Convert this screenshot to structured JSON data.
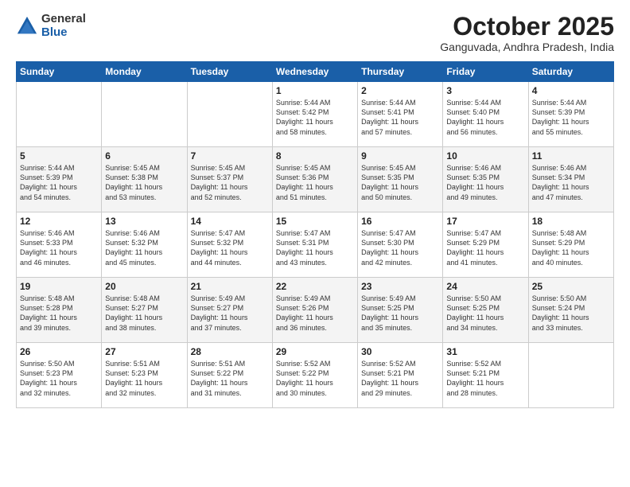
{
  "logo": {
    "general": "General",
    "blue": "Blue"
  },
  "title": "October 2025",
  "location": "Ganguvada, Andhra Pradesh, India",
  "weekdays": [
    "Sunday",
    "Monday",
    "Tuesday",
    "Wednesday",
    "Thursday",
    "Friday",
    "Saturday"
  ],
  "weeks": [
    [
      {
        "day": "",
        "content": ""
      },
      {
        "day": "",
        "content": ""
      },
      {
        "day": "",
        "content": ""
      },
      {
        "day": "1",
        "content": "Sunrise: 5:44 AM\nSunset: 5:42 PM\nDaylight: 11 hours\nand 58 minutes."
      },
      {
        "day": "2",
        "content": "Sunrise: 5:44 AM\nSunset: 5:41 PM\nDaylight: 11 hours\nand 57 minutes."
      },
      {
        "day": "3",
        "content": "Sunrise: 5:44 AM\nSunset: 5:40 PM\nDaylight: 11 hours\nand 56 minutes."
      },
      {
        "day": "4",
        "content": "Sunrise: 5:44 AM\nSunset: 5:39 PM\nDaylight: 11 hours\nand 55 minutes."
      }
    ],
    [
      {
        "day": "5",
        "content": "Sunrise: 5:44 AM\nSunset: 5:39 PM\nDaylight: 11 hours\nand 54 minutes."
      },
      {
        "day": "6",
        "content": "Sunrise: 5:45 AM\nSunset: 5:38 PM\nDaylight: 11 hours\nand 53 minutes."
      },
      {
        "day": "7",
        "content": "Sunrise: 5:45 AM\nSunset: 5:37 PM\nDaylight: 11 hours\nand 52 minutes."
      },
      {
        "day": "8",
        "content": "Sunrise: 5:45 AM\nSunset: 5:36 PM\nDaylight: 11 hours\nand 51 minutes."
      },
      {
        "day": "9",
        "content": "Sunrise: 5:45 AM\nSunset: 5:35 PM\nDaylight: 11 hours\nand 50 minutes."
      },
      {
        "day": "10",
        "content": "Sunrise: 5:46 AM\nSunset: 5:35 PM\nDaylight: 11 hours\nand 49 minutes."
      },
      {
        "day": "11",
        "content": "Sunrise: 5:46 AM\nSunset: 5:34 PM\nDaylight: 11 hours\nand 47 minutes."
      }
    ],
    [
      {
        "day": "12",
        "content": "Sunrise: 5:46 AM\nSunset: 5:33 PM\nDaylight: 11 hours\nand 46 minutes."
      },
      {
        "day": "13",
        "content": "Sunrise: 5:46 AM\nSunset: 5:32 PM\nDaylight: 11 hours\nand 45 minutes."
      },
      {
        "day": "14",
        "content": "Sunrise: 5:47 AM\nSunset: 5:32 PM\nDaylight: 11 hours\nand 44 minutes."
      },
      {
        "day": "15",
        "content": "Sunrise: 5:47 AM\nSunset: 5:31 PM\nDaylight: 11 hours\nand 43 minutes."
      },
      {
        "day": "16",
        "content": "Sunrise: 5:47 AM\nSunset: 5:30 PM\nDaylight: 11 hours\nand 42 minutes."
      },
      {
        "day": "17",
        "content": "Sunrise: 5:47 AM\nSunset: 5:29 PM\nDaylight: 11 hours\nand 41 minutes."
      },
      {
        "day": "18",
        "content": "Sunrise: 5:48 AM\nSunset: 5:29 PM\nDaylight: 11 hours\nand 40 minutes."
      }
    ],
    [
      {
        "day": "19",
        "content": "Sunrise: 5:48 AM\nSunset: 5:28 PM\nDaylight: 11 hours\nand 39 minutes."
      },
      {
        "day": "20",
        "content": "Sunrise: 5:48 AM\nSunset: 5:27 PM\nDaylight: 11 hours\nand 38 minutes."
      },
      {
        "day": "21",
        "content": "Sunrise: 5:49 AM\nSunset: 5:27 PM\nDaylight: 11 hours\nand 37 minutes."
      },
      {
        "day": "22",
        "content": "Sunrise: 5:49 AM\nSunset: 5:26 PM\nDaylight: 11 hours\nand 36 minutes."
      },
      {
        "day": "23",
        "content": "Sunrise: 5:49 AM\nSunset: 5:25 PM\nDaylight: 11 hours\nand 35 minutes."
      },
      {
        "day": "24",
        "content": "Sunrise: 5:50 AM\nSunset: 5:25 PM\nDaylight: 11 hours\nand 34 minutes."
      },
      {
        "day": "25",
        "content": "Sunrise: 5:50 AM\nSunset: 5:24 PM\nDaylight: 11 hours\nand 33 minutes."
      }
    ],
    [
      {
        "day": "26",
        "content": "Sunrise: 5:50 AM\nSunset: 5:23 PM\nDaylight: 11 hours\nand 32 minutes."
      },
      {
        "day": "27",
        "content": "Sunrise: 5:51 AM\nSunset: 5:23 PM\nDaylight: 11 hours\nand 32 minutes."
      },
      {
        "day": "28",
        "content": "Sunrise: 5:51 AM\nSunset: 5:22 PM\nDaylight: 11 hours\nand 31 minutes."
      },
      {
        "day": "29",
        "content": "Sunrise: 5:52 AM\nSunset: 5:22 PM\nDaylight: 11 hours\nand 30 minutes."
      },
      {
        "day": "30",
        "content": "Sunrise: 5:52 AM\nSunset: 5:21 PM\nDaylight: 11 hours\nand 29 minutes."
      },
      {
        "day": "31",
        "content": "Sunrise: 5:52 AM\nSunset: 5:21 PM\nDaylight: 11 hours\nand 28 minutes."
      },
      {
        "day": "",
        "content": ""
      }
    ]
  ]
}
